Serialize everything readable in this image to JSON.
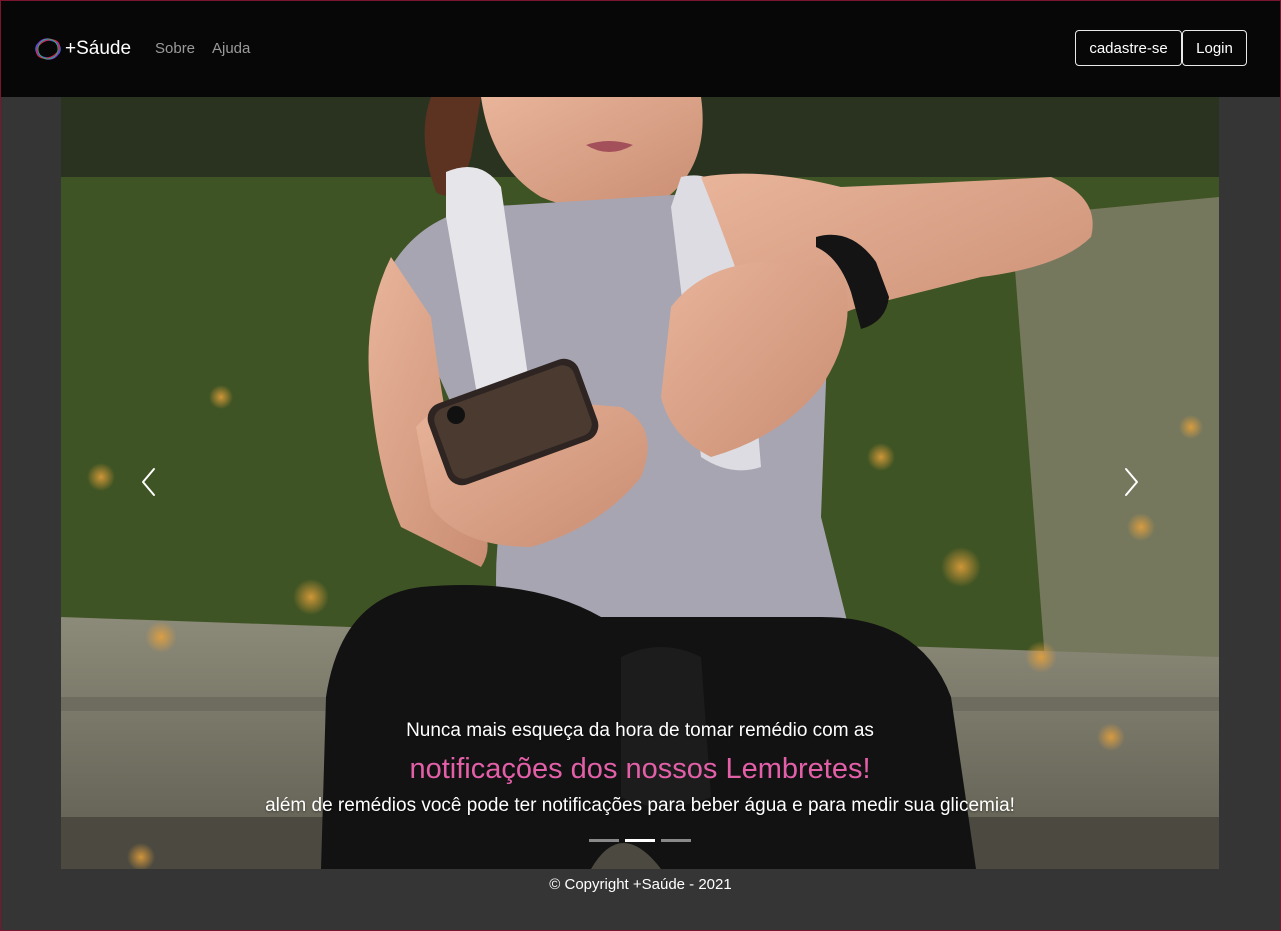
{
  "colors": {
    "navbar_bg": "#070707",
    "page_bg": "#353535",
    "accent_pink": "#e35fa8",
    "nav_link": "#9a9a9a"
  },
  "navbar": {
    "brand": "+Sáude",
    "brand_icon": "circle-logo-icon",
    "links": [
      {
        "label": "Sobre"
      },
      {
        "label": "Ajuda"
      }
    ],
    "signup_label": "cadastre-se",
    "login_label": "Login"
  },
  "carousel": {
    "prev_icon": "chevron-left-icon",
    "next_icon": "chevron-right-icon",
    "caption": {
      "line1": "Nunca mais esqueça da hora de tomar remédio com as",
      "line2": "notificações dos nossos Lembretes!",
      "line3": "além de remédios você pode ter notificações para beber água e para medir sua glicemia!"
    },
    "indicator_count": 3,
    "active_index": 1
  },
  "footer": {
    "copyright": "© Copyright +Saúde - 2021"
  }
}
